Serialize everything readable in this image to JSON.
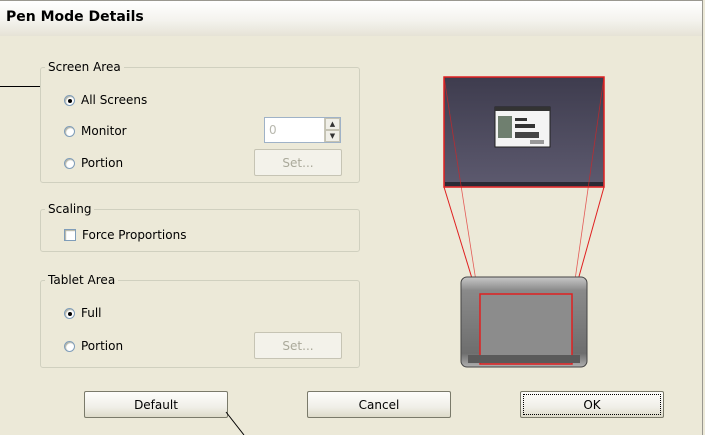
{
  "window": {
    "title": "Pen Mode Details"
  },
  "screen_area": {
    "label": "Screen Area",
    "options": [
      {
        "label": "All Screens",
        "checked": true
      },
      {
        "label": "Monitor",
        "checked": false
      },
      {
        "label": "Portion",
        "checked": false
      }
    ],
    "monitor_value": "0",
    "set_label": "Set..."
  },
  "scaling": {
    "label": "Scaling",
    "force_proportions": {
      "label": "Force Proportions",
      "checked": false
    }
  },
  "tablet_area": {
    "label": "Tablet Area",
    "options": [
      {
        "label": "Full",
        "checked": true
      },
      {
        "label": "Portion",
        "checked": false
      }
    ],
    "set_label": "Set..."
  },
  "buttons": {
    "default": "Default",
    "cancel": "Cancel",
    "ok": "OK"
  },
  "colors": {
    "highlight": "#e02020",
    "screen_bg": "#5a586a",
    "tablet_body": "#7a7a7a"
  }
}
